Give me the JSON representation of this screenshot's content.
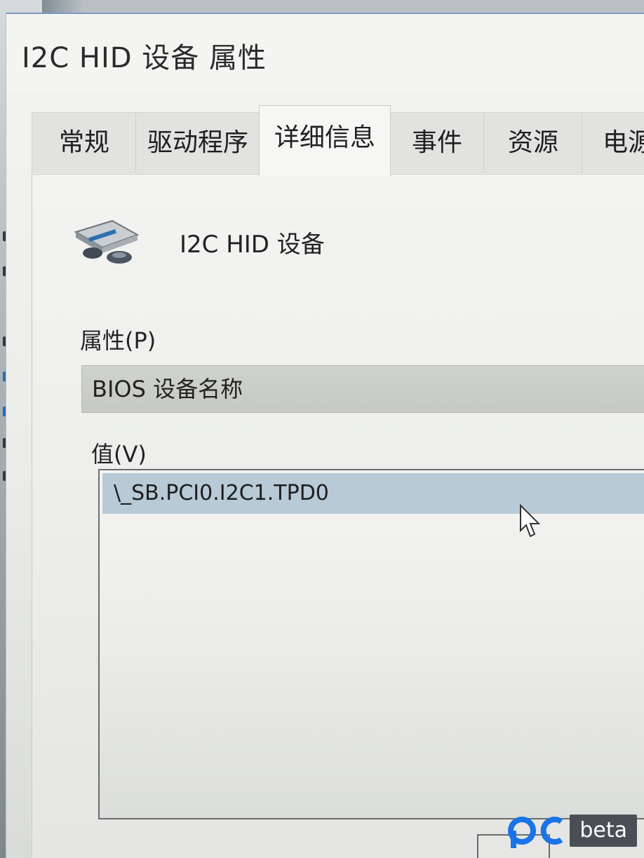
{
  "window": {
    "title": "I2C HID 设备 属性"
  },
  "tabs": [
    {
      "label": "常规"
    },
    {
      "label": "驱动程序"
    },
    {
      "label": "详细信息"
    },
    {
      "label": "事件"
    },
    {
      "label": "资源"
    },
    {
      "label": "电源"
    }
  ],
  "active_tab": "详细信息",
  "device": {
    "name": "I2C HID 设备",
    "icon": "hid-device-icon"
  },
  "property": {
    "label": "属性(P)",
    "selected": "BIOS 设备名称"
  },
  "value": {
    "label": "值(V)",
    "rows": [
      "\\_SB.PCI0.I2C1.TPD0"
    ]
  },
  "watermark": {
    "text": "beta",
    "logo_color": "#1a73e8"
  }
}
